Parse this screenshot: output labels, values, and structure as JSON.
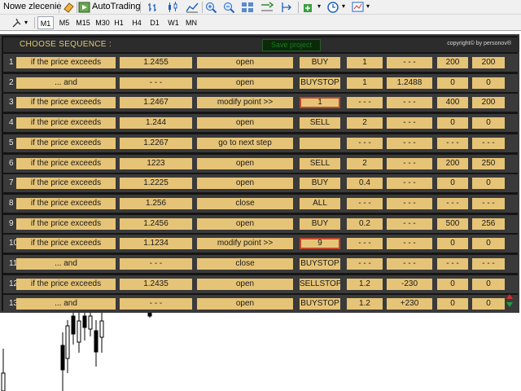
{
  "toolbar": {
    "new_order_label": "Nowe zlecenie",
    "autotrading_label": "AutoTrading",
    "timeframes": [
      "M1",
      "M5",
      "M15",
      "M30",
      "H1",
      "H4",
      "D1",
      "W1",
      "MN"
    ],
    "active_timeframe": "M1"
  },
  "panel": {
    "title": "CHOOSE SEQUENCE :",
    "save_label": "Save project",
    "copyright": "copyright© by personov®"
  },
  "rows": [
    {
      "num": "1",
      "condition": "if the price exceeds",
      "price": "1.2455",
      "action": "open",
      "type": "BUY",
      "qty": "1",
      "level": "- - -",
      "v1": "200",
      "v2": "200",
      "hl": false
    },
    {
      "num": "2",
      "condition": "...  and",
      "price": "- - -",
      "action": "open",
      "type": "BUYSTOP",
      "qty": "1",
      "level": "1.2488",
      "v1": "0",
      "v2": "0",
      "hl": false
    },
    {
      "num": "3",
      "condition": "if the price exceeds",
      "price": "1.2467",
      "action": "modify point  >>",
      "type": "1",
      "qty": "- - -",
      "level": "- - -",
      "v1": "400",
      "v2": "200",
      "hl": true
    },
    {
      "num": "4",
      "condition": "if the price exceeds",
      "price": "1.244",
      "action": "open",
      "type": "SELL",
      "qty": "2",
      "level": "- - -",
      "v1": "0",
      "v2": "0",
      "hl": false
    },
    {
      "num": "5",
      "condition": "if the price exceeds",
      "price": "1.2267",
      "action": "go to next step",
      "type": "",
      "qty": "- - -",
      "level": "- - -",
      "v1": "- - -",
      "v2": "- - -",
      "hl": false
    },
    {
      "num": "6",
      "condition": "if the price exceeds",
      "price": "1223",
      "action": "open",
      "type": "SELL",
      "qty": "2",
      "level": "- - -",
      "v1": "200",
      "v2": "250",
      "hl": false
    },
    {
      "num": "7",
      "condition": "if the price exceeds",
      "price": "1.2225",
      "action": "open",
      "type": "BUY",
      "qty": "0.4",
      "level": "- - -",
      "v1": "0",
      "v2": "0",
      "hl": false
    },
    {
      "num": "8",
      "condition": "if the price exceeds",
      "price": "1.256",
      "action": "close",
      "type": "ALL",
      "qty": "- - -",
      "level": "- - -",
      "v1": "- - -",
      "v2": "- - -",
      "hl": false
    },
    {
      "num": "9",
      "condition": "if the price exceeds",
      "price": "1.2456",
      "action": "open",
      "type": "BUY",
      "qty": "0.2",
      "level": "- - -",
      "v1": "500",
      "v2": "256",
      "hl": false
    },
    {
      "num": "10",
      "condition": "if the price exceeds",
      "price": "1.1234",
      "action": "modify point  >>",
      "type": "9",
      "qty": "- - -",
      "level": "- - -",
      "v1": "0",
      "v2": "0",
      "hl": true
    },
    {
      "num": "11",
      "condition": "...  and",
      "price": "- - -",
      "action": "close",
      "type": "BUYSTOP",
      "qty": "- - -",
      "level": "- - -",
      "v1": "- - -",
      "v2": "- - -",
      "hl": false
    },
    {
      "num": "12",
      "condition": "if the price exceeds",
      "price": "1.2435",
      "action": "open",
      "type": "SELLSTOP",
      "qty": "1.2",
      "level": "-230",
      "v1": "0",
      "v2": "0",
      "hl": false
    },
    {
      "num": "13",
      "condition": "...  and",
      "price": "- - -",
      "action": "open",
      "type": "BUYSTOP",
      "qty": "1.2",
      "level": "+230",
      "v1": "0",
      "v2": "0",
      "hl": false
    }
  ],
  "colors": {
    "panel_bg": "#151515",
    "row_bg": "#3a3a3a",
    "cell_bg": "#e6c477",
    "title_color": "#e4c978",
    "highlight_border": "#c44a2c",
    "candle_color": "#000000"
  }
}
